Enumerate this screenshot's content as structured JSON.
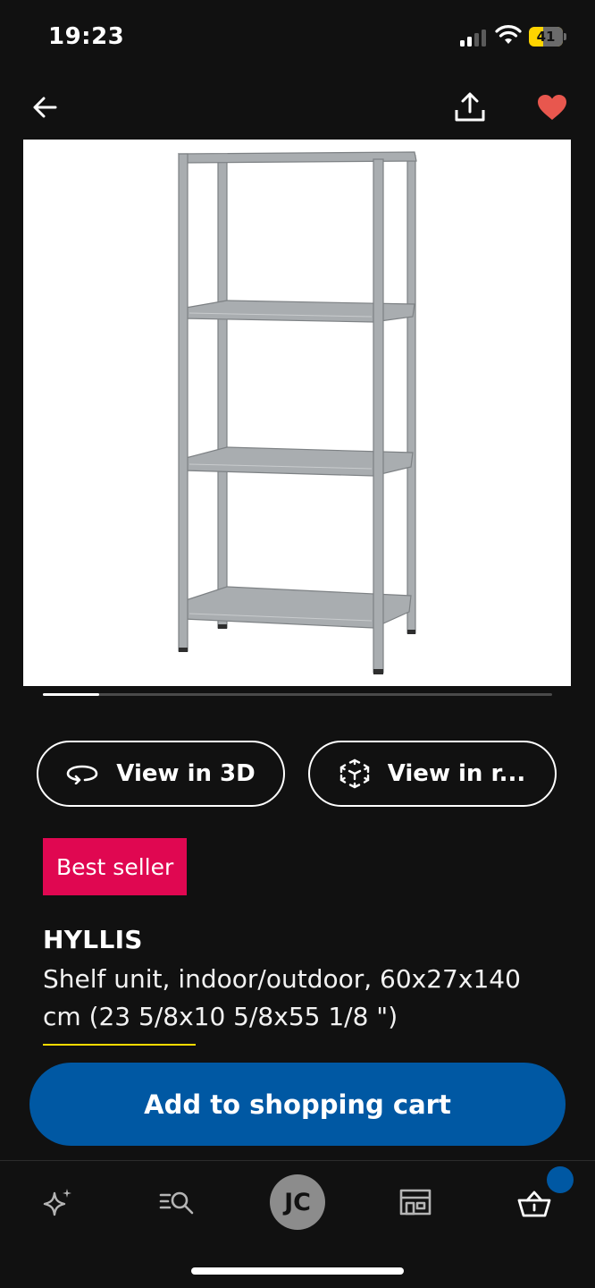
{
  "status_bar": {
    "time": "19:23",
    "battery_level": "41"
  },
  "nav": {
    "back_icon": "arrow-left-icon",
    "share_icon": "share-icon",
    "favorite_icon": "heart-icon",
    "favorite_color": "#e8574e"
  },
  "product_image": {
    "icon": "shelf-unit-image"
  },
  "carousel": {
    "progress_fraction": 0.11
  },
  "view_buttons": {
    "view_3d": "View in 3D",
    "view_room": "View in r..."
  },
  "badge": {
    "label": "Best seller",
    "color": "#e00751"
  },
  "product": {
    "name": "HYLLIS",
    "description": "Shelf unit, indoor/outdoor, 60x27x140 cm (23 5/8x10 5/8x55 1/8 \")"
  },
  "cart_button": {
    "label": "Add to shopping cart",
    "color": "#0058a3"
  },
  "tab_bar": {
    "inspiration_icon": "sparkle-icon",
    "search_icon": "search-list-icon",
    "profile_initials": "JC",
    "stores_icon": "store-icon",
    "cart_icon": "basket-icon",
    "cart_badge_color": "#0058a3"
  }
}
